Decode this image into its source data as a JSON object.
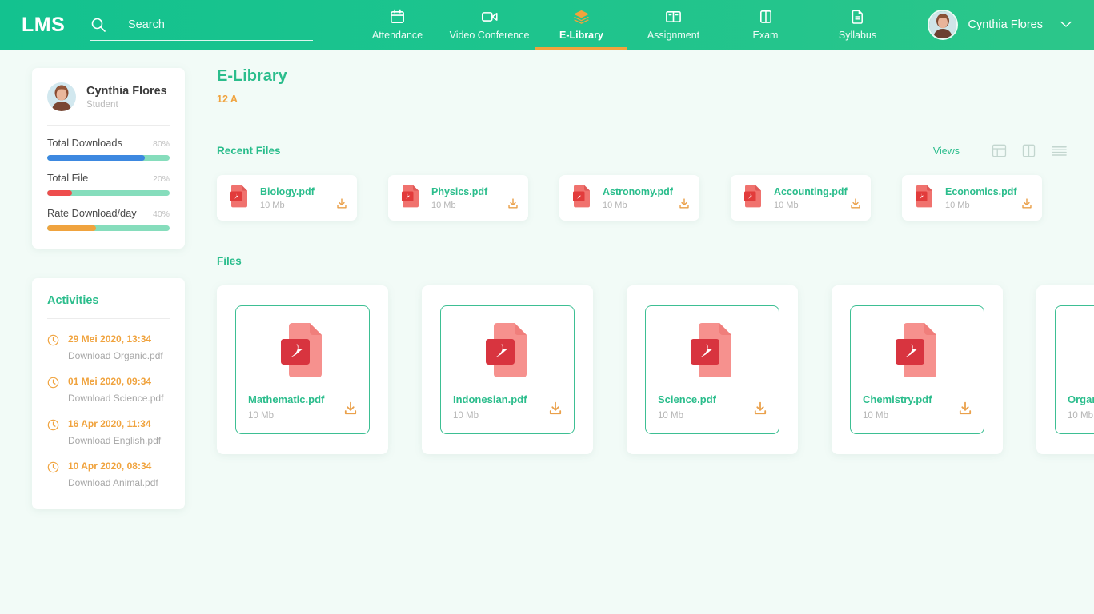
{
  "header": {
    "logo": "LMS",
    "search": {
      "placeholder": "Search",
      "value": "",
      "icon": "search-icon"
    },
    "nav": [
      {
        "label": "Attendance",
        "icon": "calendar-icon",
        "active": false
      },
      {
        "label": "Video Conference",
        "icon": "video-camera-icon",
        "active": false
      },
      {
        "label": "E-Library",
        "icon": "layers-icon",
        "active": true
      },
      {
        "label": "Assignment",
        "icon": "open-book-icon",
        "active": false
      },
      {
        "label": "Exam",
        "icon": "book-icon",
        "active": false
      },
      {
        "label": "Syllabus",
        "icon": "document-icon",
        "active": false
      }
    ],
    "user": {
      "name": "Cynthia Flores",
      "chevron": "chevron-down-icon"
    }
  },
  "sidebar": {
    "profile": {
      "name": "Cynthia Flores",
      "role": "Student"
    },
    "stats": [
      {
        "label": "Total Downloads",
        "percent": "80%",
        "value": 80,
        "color": "#3d88e0"
      },
      {
        "label": "Total File",
        "percent": "20%",
        "value": 20,
        "color": "#ee4d4d"
      },
      {
        "label": "Rate Download/day",
        "percent": "40%",
        "value": 40,
        "color": "#f0a33e"
      }
    ],
    "track_color": "#86ddbc",
    "activities": {
      "title": "Activities",
      "items": [
        {
          "date": "29 Mei 2020, 13:34",
          "desc": "Download Organic.pdf",
          "icon": "clock-icon"
        },
        {
          "date": "01 Mei 2020, 09:34",
          "desc": "Download Science.pdf",
          "icon": "clock-icon"
        },
        {
          "date": "16 Apr 2020, 11:34",
          "desc": "Download English.pdf",
          "icon": "clock-icon"
        },
        {
          "date": "10 Apr 2020, 08:34",
          "desc": "Download Animal.pdf",
          "icon": "clock-icon"
        }
      ]
    }
  },
  "main": {
    "title": "E-Library",
    "subtitle": "12 A",
    "recent_section": {
      "title": "Recent Files"
    },
    "views": {
      "label": "Views",
      "buttons": [
        {
          "icon": "grid-view-icon",
          "active": false
        },
        {
          "icon": "split-view-icon",
          "active": false
        },
        {
          "icon": "list-view-icon",
          "active": false
        }
      ]
    },
    "recent_files": [
      {
        "name": "Biology.pdf",
        "size": "10 Mb",
        "icon": "pdf-icon",
        "download": "download-icon"
      },
      {
        "name": "Physics.pdf",
        "size": "10 Mb",
        "icon": "pdf-icon",
        "download": "download-icon"
      },
      {
        "name": "Astronomy.pdf",
        "size": "10 Mb",
        "icon": "pdf-icon",
        "download": "download-icon"
      },
      {
        "name": "Accounting.pdf",
        "size": "10 Mb",
        "icon": "pdf-icon",
        "download": "download-icon"
      },
      {
        "name": "Economics.pdf",
        "size": "10 Mb",
        "icon": "pdf-icon",
        "download": "download-icon"
      }
    ],
    "files_section": {
      "title": "Files"
    },
    "files": [
      {
        "name": "Mathematic.pdf",
        "size": "10 Mb",
        "icon": "pdf-icon",
        "download": "download-icon"
      },
      {
        "name": "Indonesian.pdf",
        "size": "10 Mb",
        "icon": "pdf-icon",
        "download": "download-icon"
      },
      {
        "name": "Science.pdf",
        "size": "10 Mb",
        "icon": "pdf-icon",
        "download": "download-icon"
      },
      {
        "name": "Chemistry.pdf",
        "size": "10 Mb",
        "icon": "pdf-icon",
        "download": "download-icon"
      },
      {
        "name": "Organic.pdf",
        "size": "10 Mb",
        "icon": "pdf-icon",
        "download": "download-icon"
      }
    ]
  },
  "colors": {
    "brand_teal": "#2bbd8c",
    "accent_orange": "#f0a33e",
    "pdf_red": "#ef5350",
    "background": "#f2fbf7"
  }
}
